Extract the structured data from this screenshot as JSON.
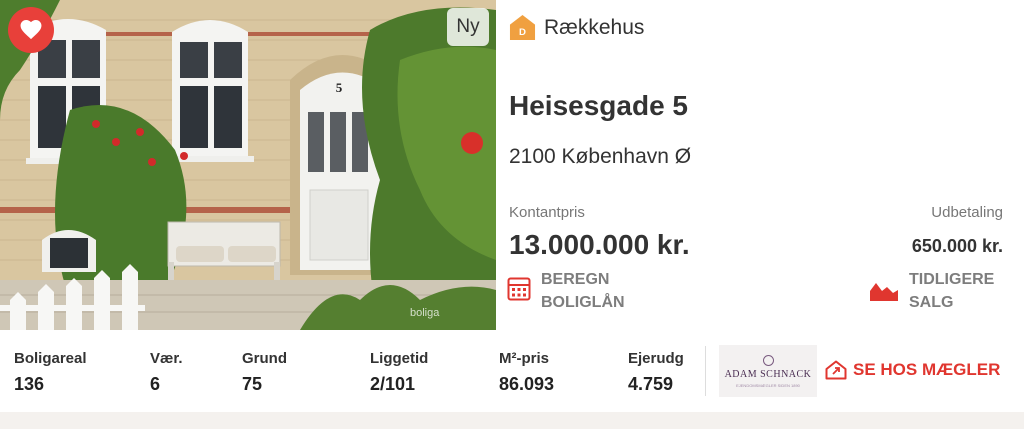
{
  "listing": {
    "badge_new": "Ny",
    "property_type": "Rækkehus",
    "type_icon_letter": "D",
    "address": "Heisesgade 5",
    "city": "2100 København Ø",
    "photo_watermark": "boliga",
    "house_number": "5",
    "price_label": "Kontantpris",
    "price": "13.000.000 kr.",
    "down_payment_label": "Udbetaling",
    "down_payment": "650.000 kr."
  },
  "actions": {
    "loan_calc": "BEREGN BOLIGLÅN",
    "previous_sales": "TIDLIGERE SALG",
    "see_broker": "SE HOS MÆGLER"
  },
  "stats": [
    {
      "label": "Boligareal",
      "value": "136"
    },
    {
      "label": "Vær.",
      "value": "6"
    },
    {
      "label": "Grund",
      "value": "75"
    },
    {
      "label": "Liggetid",
      "value": "2/101"
    },
    {
      "label": "M²-pris",
      "value": "86.093"
    },
    {
      "label": "Ejerudg",
      "value": "4.759"
    }
  ],
  "broker": {
    "name": "ADAM SCHNACK",
    "tagline": "EJENDOMSMÆGLER SIDEN 1890"
  },
  "colors": {
    "accent_red": "#e0362f",
    "favorite_red": "#e8403a",
    "type_icon_orange": "#f0a040",
    "muted_text": "#7d7d7d"
  },
  "icons": {
    "favorite": "heart-icon",
    "property_type": "house-icon",
    "loan": "calculator-icon",
    "sales": "area-chart-icon",
    "broker": "house-link-icon"
  }
}
